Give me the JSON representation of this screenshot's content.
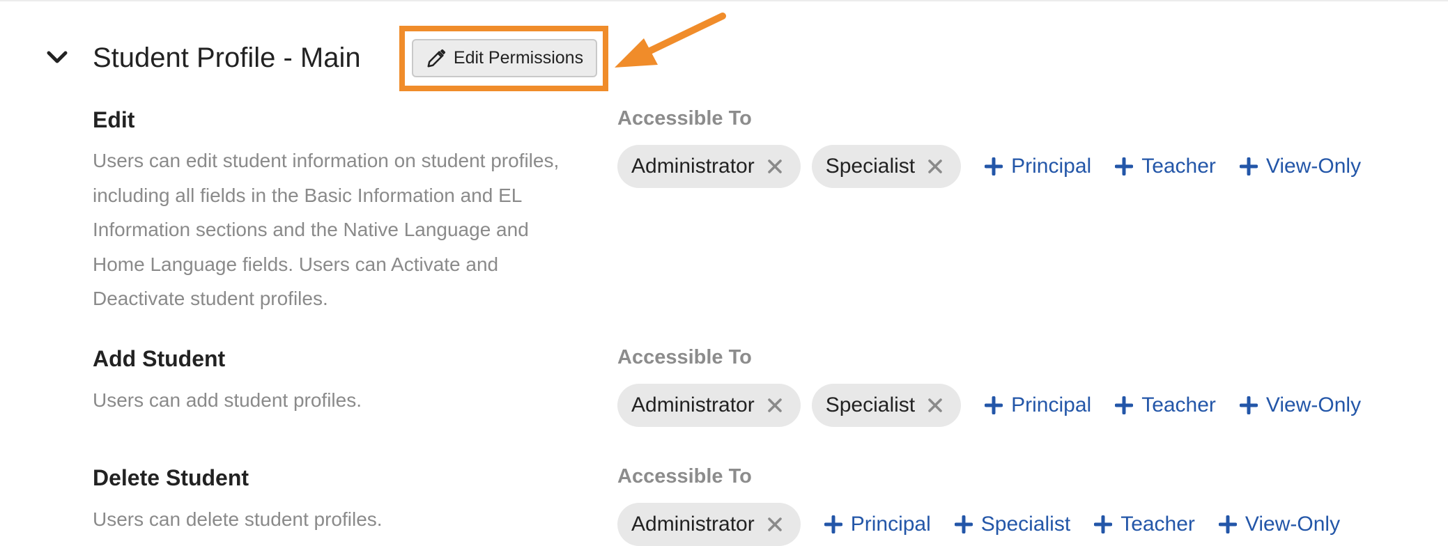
{
  "section": {
    "title": "Student Profile - Main",
    "edit_button_label": "Edit Permissions"
  },
  "annotation": {
    "highlight_color": "#f08c2a"
  },
  "colors": {
    "link": "#2356a8",
    "chip_bg": "#e8e8e8",
    "muted_text": "#8a8a8a"
  },
  "permissions": [
    {
      "title": "Edit",
      "description": "Users can edit student information on student profiles, including all fields in the Basic Information and EL Information sections and the Native Language and Home Language fields. Users can Activate and Deactivate student profiles.",
      "accessible_label": "Accessible To",
      "granted": [
        "Administrator",
        "Specialist"
      ],
      "available": [
        "Principal",
        "Teacher",
        "View-Only"
      ]
    },
    {
      "title": "Add Student",
      "description": "Users can add student profiles.",
      "accessible_label": "Accessible To",
      "granted": [
        "Administrator",
        "Specialist"
      ],
      "available": [
        "Principal",
        "Teacher",
        "View-Only"
      ]
    },
    {
      "title": "Delete Student",
      "description": "Users can delete student profiles.",
      "accessible_label": "Accessible To",
      "granted": [
        "Administrator"
      ],
      "available": [
        "Principal",
        "Specialist",
        "Teacher",
        "View-Only"
      ]
    }
  ]
}
